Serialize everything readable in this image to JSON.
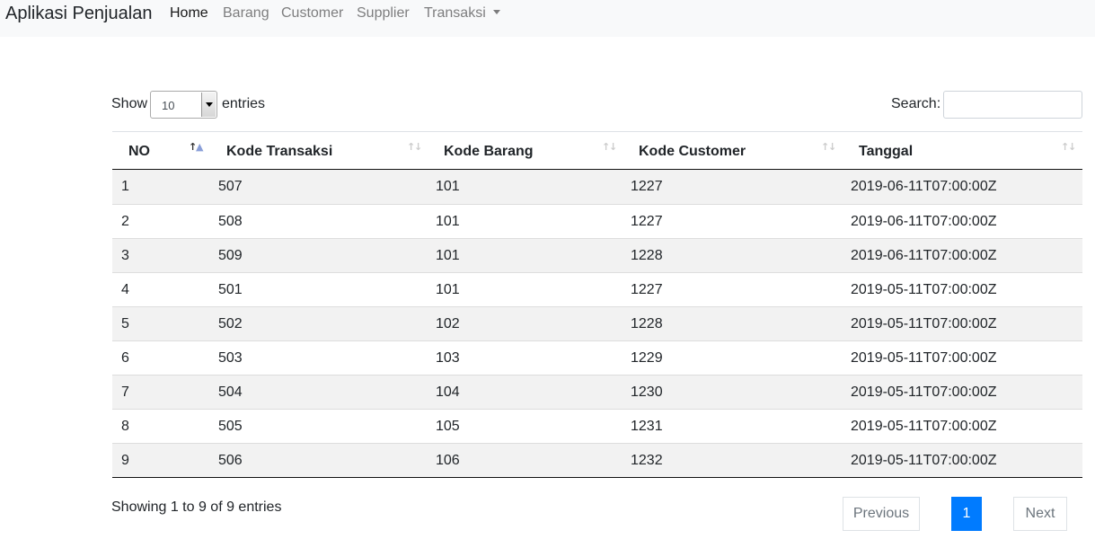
{
  "navbar": {
    "brand": "Aplikasi Penjualan",
    "items": [
      {
        "label": "Home",
        "active": true
      },
      {
        "label": "Barang",
        "active": false
      },
      {
        "label": "Customer",
        "active": false
      },
      {
        "label": "Supplier",
        "active": false
      },
      {
        "label": "Transaksi",
        "active": false,
        "dropdown": true
      }
    ]
  },
  "controls": {
    "show_label": "Show",
    "entries_value": "10",
    "entries_label": "entries",
    "search_label": "Search:",
    "search_value": ""
  },
  "table": {
    "columns": [
      {
        "label": "NO",
        "sort": "asc"
      },
      {
        "label": "Kode Transaksi",
        "sort": "none"
      },
      {
        "label": "Kode Barang",
        "sort": "none"
      },
      {
        "label": "Kode Customer",
        "sort": "none"
      },
      {
        "label": "Tanggal",
        "sort": "none"
      }
    ],
    "rows": [
      [
        "1",
        "507",
        "101",
        "1227",
        "2019-06-11T07:00:00Z"
      ],
      [
        "2",
        "508",
        "101",
        "1227",
        "2019-06-11T07:00:00Z"
      ],
      [
        "3",
        "509",
        "101",
        "1228",
        "2019-06-11T07:00:00Z"
      ],
      [
        "4",
        "501",
        "101",
        "1227",
        "2019-05-11T07:00:00Z"
      ],
      [
        "5",
        "502",
        "102",
        "1228",
        "2019-05-11T07:00:00Z"
      ],
      [
        "6",
        "503",
        "103",
        "1229",
        "2019-05-11T07:00:00Z"
      ],
      [
        "7",
        "504",
        "104",
        "1230",
        "2019-05-11T07:00:00Z"
      ],
      [
        "8",
        "505",
        "105",
        "1231",
        "2019-05-11T07:00:00Z"
      ],
      [
        "9",
        "506",
        "106",
        "1232",
        "2019-05-11T07:00:00Z"
      ]
    ]
  },
  "footer": {
    "info": "Showing 1 to 9 of 9 entries",
    "previous": "Previous",
    "current_page": "1",
    "next": "Next"
  },
  "colors": {
    "navbar_bg": "#f8f9fa",
    "accent": "#007bff",
    "stripe": "#f2f2f2"
  }
}
